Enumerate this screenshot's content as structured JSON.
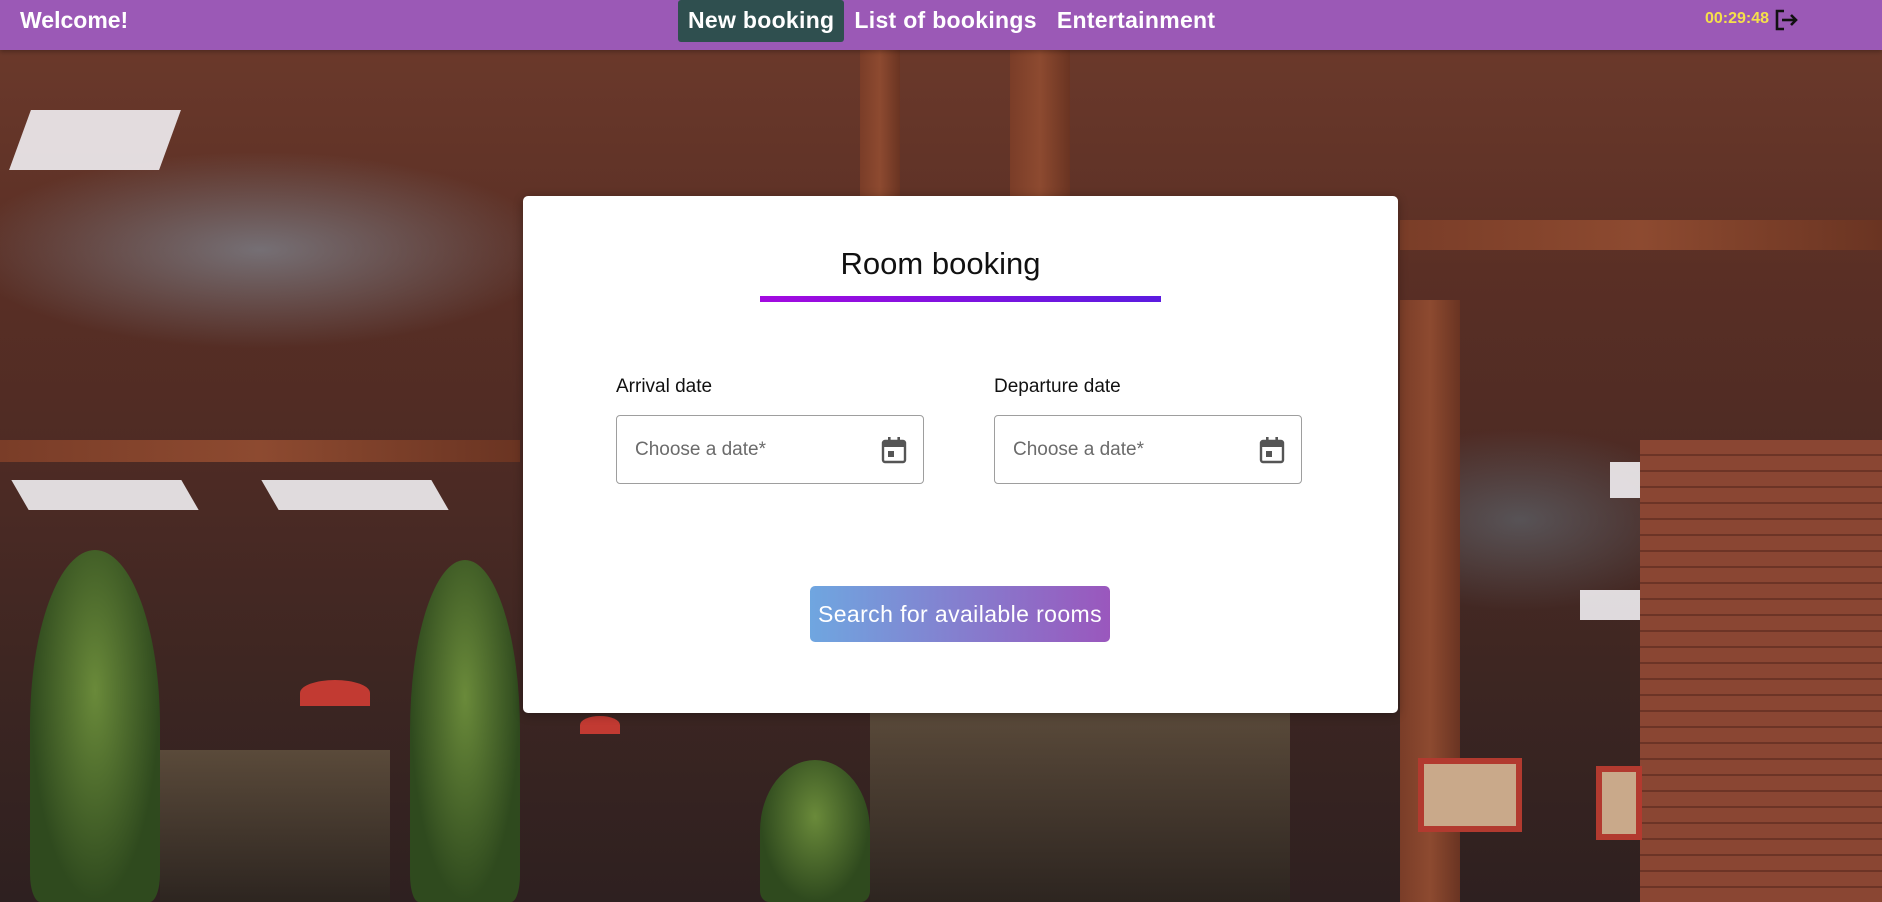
{
  "header": {
    "welcome": "Welcome!",
    "nav": [
      {
        "label": "New booking",
        "active": true
      },
      {
        "label": "List of bookings",
        "active": false
      },
      {
        "label": "Entertainment",
        "active": false
      }
    ],
    "timer": "00:29:48",
    "logout_icon": "logout-icon"
  },
  "booking_form": {
    "title": "Room booking",
    "arrival": {
      "label": "Arrival date",
      "placeholder": "Choose a date*",
      "value": "",
      "icon": "calendar-icon"
    },
    "departure": {
      "label": "Departure date",
      "placeholder": "Choose a date*",
      "value": "",
      "icon": "calendar-icon"
    },
    "submit_label": "Search for available rooms"
  },
  "colors": {
    "topbar": "#9b59b6",
    "active_nav": "#2f4f4f",
    "timer": "#f5e04a",
    "underline_start": "#a30ae0",
    "underline_end": "#5b1be0",
    "button_start": "#6fa6e0",
    "button_end": "#9a57bd"
  }
}
